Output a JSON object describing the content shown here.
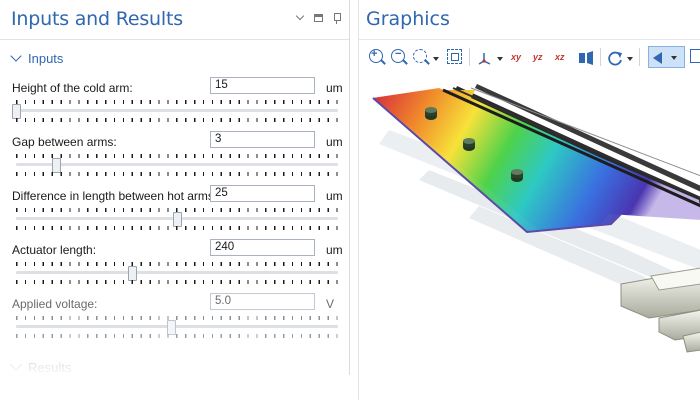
{
  "inputs_panel": {
    "title": "Inputs and Results",
    "inputs_section": "Inputs",
    "results_section": "Results",
    "rows": [
      {
        "label": "Height of the cold arm:",
        "value": "15",
        "unit": "um",
        "slider_fraction": 0.0,
        "enabled": true
      },
      {
        "label": "Gap between arms:",
        "value": "3",
        "unit": "um",
        "slider_fraction": 0.125,
        "enabled": true
      },
      {
        "label": "Difference in length between hot arms:",
        "value": "25",
        "unit": "um",
        "slider_fraction": 0.5,
        "enabled": true
      },
      {
        "label": "Actuator length:",
        "value": "240",
        "unit": "um",
        "slider_fraction": 0.36,
        "enabled": true
      },
      {
        "label": "Applied voltage:",
        "value": "5.0",
        "unit": "V",
        "slider_fraction": 0.48,
        "enabled": false
      }
    ]
  },
  "graphics_panel": {
    "title": "Graphics",
    "toolbar_icons": [
      "zoom-in-icon",
      "zoom-out-icon",
      "zoom-box-icon",
      "zoom-extents-icon",
      "axis-orientation-icon",
      "xy-view-icon",
      "yz-view-icon",
      "xz-view-icon",
      "go-to-view-icon",
      "rotate-icon",
      "speaker-icon",
      "frame-icon"
    ],
    "axis_labels": {
      "xy": "xy",
      "yz": "yz",
      "xz": "xz"
    }
  },
  "colors": {
    "accent": "#2f67b1",
    "thermal_hot": "#d7263d",
    "thermal_cold": "#3a2f9e"
  }
}
